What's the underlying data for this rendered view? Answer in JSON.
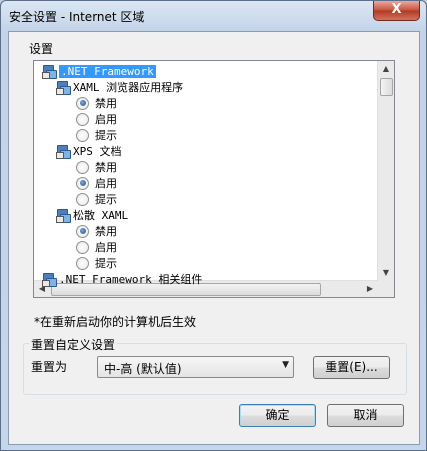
{
  "window": {
    "title": "安全设置 - Internet 区域",
    "close_glyph": "X"
  },
  "settings_group": {
    "label": "设置"
  },
  "tree": [
    {
      "kind": "header",
      "text": ".NET Framework",
      "selected": true,
      "indent": 0
    },
    {
      "kind": "header",
      "text": "XAML 浏览器应用程序",
      "indent": 1
    },
    {
      "kind": "radio",
      "text": "禁用",
      "checked": true,
      "indent": 2
    },
    {
      "kind": "radio",
      "text": "启用",
      "checked": false,
      "indent": 2
    },
    {
      "kind": "radio",
      "text": "提示",
      "checked": false,
      "indent": 2
    },
    {
      "kind": "header",
      "text": "XPS 文档",
      "indent": 1
    },
    {
      "kind": "radio",
      "text": "禁用",
      "checked": false,
      "indent": 2
    },
    {
      "kind": "radio",
      "text": "启用",
      "checked": true,
      "indent": 2
    },
    {
      "kind": "radio",
      "text": "提示",
      "checked": false,
      "indent": 2
    },
    {
      "kind": "header",
      "text": "松散 XAML",
      "indent": 1
    },
    {
      "kind": "radio",
      "text": "禁用",
      "checked": true,
      "indent": 2
    },
    {
      "kind": "radio",
      "text": "启用",
      "checked": false,
      "indent": 2
    },
    {
      "kind": "radio",
      "text": "提示",
      "checked": false,
      "indent": 2
    },
    {
      "kind": "header",
      "text": ".NET Framework 相关组件",
      "indent": 0
    }
  ],
  "note": "*在重新启动你的计算机后生效",
  "reset_group": {
    "label": "重置自定义设置",
    "reset_to_label": "重置为",
    "combo_value": "中-高 (默认值)",
    "reset_button": "重置(E)..."
  },
  "buttons": {
    "ok": "确定",
    "cancel": "取消"
  }
}
